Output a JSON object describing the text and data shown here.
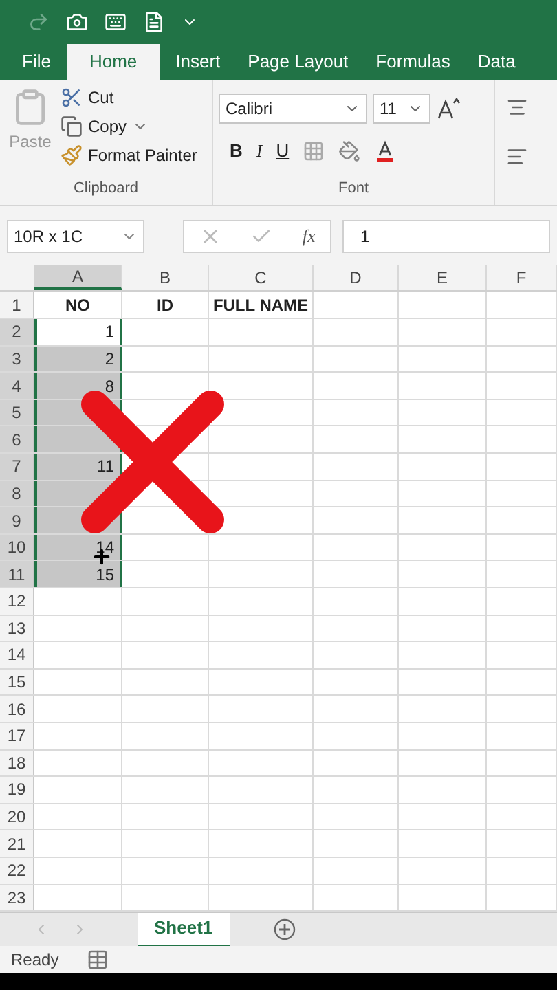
{
  "tabs": [
    {
      "label": "File",
      "selected": false
    },
    {
      "label": "Home",
      "selected": true
    },
    {
      "label": "Insert",
      "selected": false
    },
    {
      "label": "Page Layout",
      "selected": false
    },
    {
      "label": "Formulas",
      "selected": false
    },
    {
      "label": "Data",
      "selected": false
    }
  ],
  "clipboard": {
    "paste": "Paste",
    "cut": "Cut",
    "copy": "Copy",
    "format_painter": "Format Painter",
    "group_label": "Clipboard"
  },
  "font": {
    "name": "Calibri",
    "size": "11",
    "bold": "B",
    "italic": "I",
    "underline": "U",
    "group_label": "Font"
  },
  "formula_bar": {
    "name_box": "10R x 1C",
    "function_label": "fx",
    "value": "1"
  },
  "columns": [
    {
      "label": "A",
      "selected": true
    },
    {
      "label": "B",
      "selected": false
    },
    {
      "label": "C",
      "selected": false
    },
    {
      "label": "D",
      "selected": false
    },
    {
      "label": "E",
      "selected": false
    },
    {
      "label": "F",
      "selected": false
    }
  ],
  "rows": [
    {
      "kind": "header",
      "number": "1",
      "selected": false,
      "cells": [
        "NO",
        "ID",
        "FULL NAME"
      ]
    },
    {
      "kind": "data",
      "number": "2",
      "selected": true,
      "active": true,
      "cells": [
        "1"
      ]
    },
    {
      "kind": "data",
      "number": "3",
      "selected": true,
      "active": false,
      "cells": [
        "2"
      ]
    },
    {
      "kind": "data",
      "number": "4",
      "selected": true,
      "active": false,
      "cells": [
        "8"
      ]
    },
    {
      "kind": "data",
      "number": "5",
      "selected": true,
      "active": false,
      "cells": []
    },
    {
      "kind": "data",
      "number": "6",
      "selected": true,
      "active": false,
      "cells": []
    },
    {
      "kind": "data",
      "number": "7",
      "selected": true,
      "active": false,
      "cells": [
        "11"
      ]
    },
    {
      "kind": "data",
      "number": "8",
      "selected": true,
      "active": false,
      "cells": []
    },
    {
      "kind": "data",
      "number": "9",
      "selected": true,
      "active": false,
      "cells": []
    },
    {
      "kind": "data",
      "number": "10",
      "selected": true,
      "active": false,
      "cells": [
        "14"
      ]
    },
    {
      "kind": "data",
      "number": "11",
      "selected": true,
      "active": false,
      "cells": [
        "15"
      ]
    },
    {
      "kind": "data",
      "number": "12",
      "selected": false,
      "cells": []
    },
    {
      "kind": "data",
      "number": "13",
      "selected": false,
      "cells": []
    },
    {
      "kind": "data",
      "number": "14",
      "selected": false,
      "cells": []
    },
    {
      "kind": "data",
      "number": "15",
      "selected": false,
      "cells": []
    },
    {
      "kind": "data",
      "number": "16",
      "selected": false,
      "cells": []
    },
    {
      "kind": "data",
      "number": "17",
      "selected": false,
      "cells": []
    },
    {
      "kind": "data",
      "number": "18",
      "selected": false,
      "cells": []
    },
    {
      "kind": "data",
      "number": "19",
      "selected": false,
      "cells": []
    },
    {
      "kind": "data",
      "number": "20",
      "selected": false,
      "cells": []
    },
    {
      "kind": "data",
      "number": "21",
      "selected": false,
      "cells": []
    },
    {
      "kind": "data",
      "number": "22",
      "selected": false,
      "cells": []
    },
    {
      "kind": "data",
      "number": "23",
      "selected": false,
      "cells": []
    }
  ],
  "sheet_tabs": [
    {
      "label": "Sheet1",
      "selected": true
    }
  ],
  "status": "Ready"
}
